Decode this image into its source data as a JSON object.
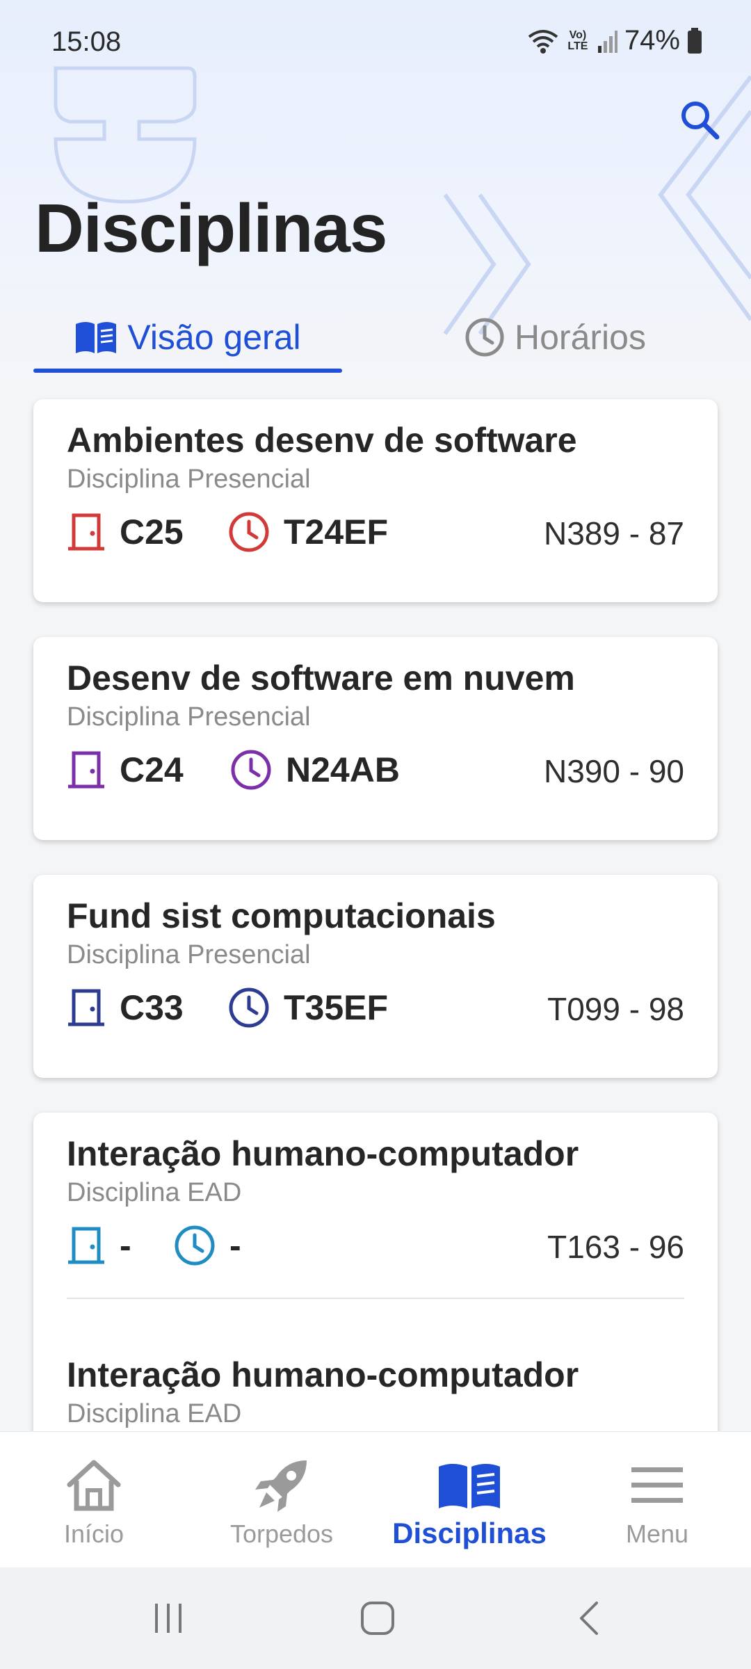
{
  "status_bar": {
    "time": "15:08",
    "battery": "74%",
    "icons": [
      "wifi-icon",
      "volte-icon",
      "signal-icon",
      "battery-icon"
    ],
    "volte_label": "Vo) LTE"
  },
  "header": {
    "title": "Disciplinas",
    "search_icon": "search-icon"
  },
  "tabs": [
    {
      "label": "Visão geral",
      "icon": "book-icon",
      "active": true
    },
    {
      "label": "Horários",
      "icon": "clock-icon",
      "active": false
    }
  ],
  "courses": [
    {
      "name": "Ambientes desenv de software",
      "type": "Disciplina Presencial",
      "room": "C25",
      "schedule": "T24EF",
      "code": "N389 - 87",
      "color": "#d23a3a"
    },
    {
      "name": "Desenv de software em nuvem",
      "type": "Disciplina Presencial",
      "room": "C24",
      "schedule": "N24AB",
      "code": "N390 - 90",
      "color": "#7b2fa8"
    },
    {
      "name": "Fund sist computacionais",
      "type": "Disciplina Presencial",
      "room": "C33",
      "schedule": "T35EF",
      "code": "T099 - 98",
      "color": "#2e3b92"
    },
    {
      "name": "Interação humano-computador",
      "type": "Disciplina EAD",
      "room": "-",
      "schedule": "-",
      "code": "T163 - 96",
      "color": "#1f8cc4"
    },
    {
      "name": "Interação humano-computador",
      "type": "Disciplina EAD"
    }
  ],
  "bottom_nav": [
    {
      "label": "Início",
      "icon": "home-icon",
      "active": false
    },
    {
      "label": "Torpedos",
      "icon": "rocket-icon",
      "active": false
    },
    {
      "label": "Disciplinas",
      "icon": "book-icon",
      "active": true
    },
    {
      "label": "Menu",
      "icon": "menu-icon",
      "active": false
    }
  ],
  "system_nav": [
    "recents-button",
    "home-button",
    "back-button"
  ],
  "colors": {
    "accent": "#1f4fd6",
    "inactive": "#9a9a9a"
  }
}
